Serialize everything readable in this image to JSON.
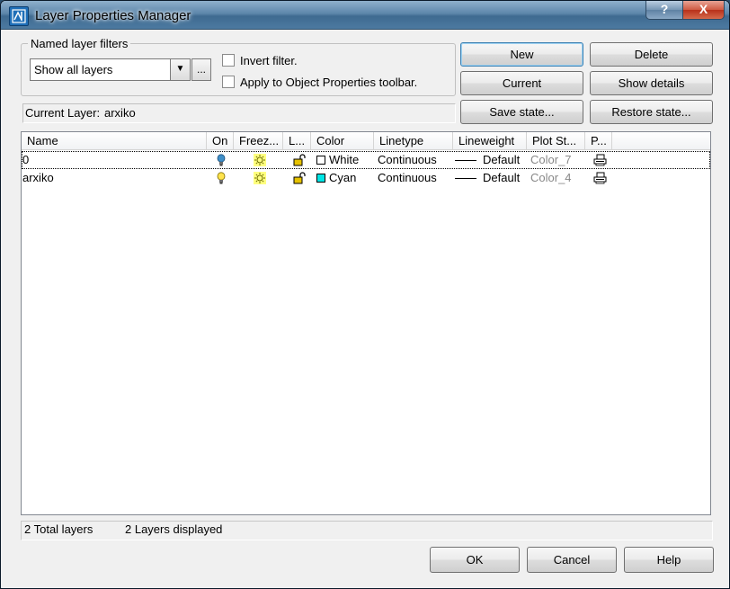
{
  "window": {
    "title": "Layer Properties Manager",
    "help_glyph": "?",
    "close_glyph": "X",
    "accent_color": "#5d87ab"
  },
  "filters": {
    "group_label": "Named layer filters",
    "selected": "Show all layers",
    "browse_label": "...",
    "invert_label": "Invert filter.",
    "invert_checked": false,
    "apply_label": "Apply to Object Properties toolbar.",
    "apply_checked": false
  },
  "current_layer": {
    "label": "Current Layer:",
    "value": "arxiko"
  },
  "buttons": {
    "new": "New",
    "delete": "Delete",
    "current": "Current",
    "show_details": "Show details",
    "save_state": "Save state...",
    "restore_state": "Restore state..."
  },
  "table": {
    "columns": [
      "Name",
      "On",
      "Freez...",
      "L...",
      "Color",
      "Linetype",
      "Lineweight",
      "Plot St...",
      "P..."
    ],
    "rows": [
      {
        "name": "0",
        "on_icon": "lightbulb-on-icon",
        "freeze_icon": "sun-thawed-icon",
        "lock_icon": "unlocked-icon",
        "color_name": "White",
        "color_hex": "#ffffff",
        "linetype": "Continuous",
        "lineweight": "Default",
        "plot_style": "Color_7",
        "plot_icon": "printer-icon",
        "selected": true
      },
      {
        "name": "arxiko",
        "on_icon": "lightbulb-on-icon",
        "freeze_icon": "sun-thawed-icon",
        "lock_icon": "unlocked-icon",
        "color_name": "Cyan",
        "color_hex": "#00e5e5",
        "linetype": "Continuous",
        "lineweight": "Default",
        "plot_style": "Color_4",
        "plot_icon": "printer-icon",
        "selected": false
      }
    ]
  },
  "status": {
    "total": "2 Total layers",
    "displayed": "2 Layers displayed"
  },
  "footer": {
    "ok": "OK",
    "cancel": "Cancel",
    "help": "Help"
  }
}
